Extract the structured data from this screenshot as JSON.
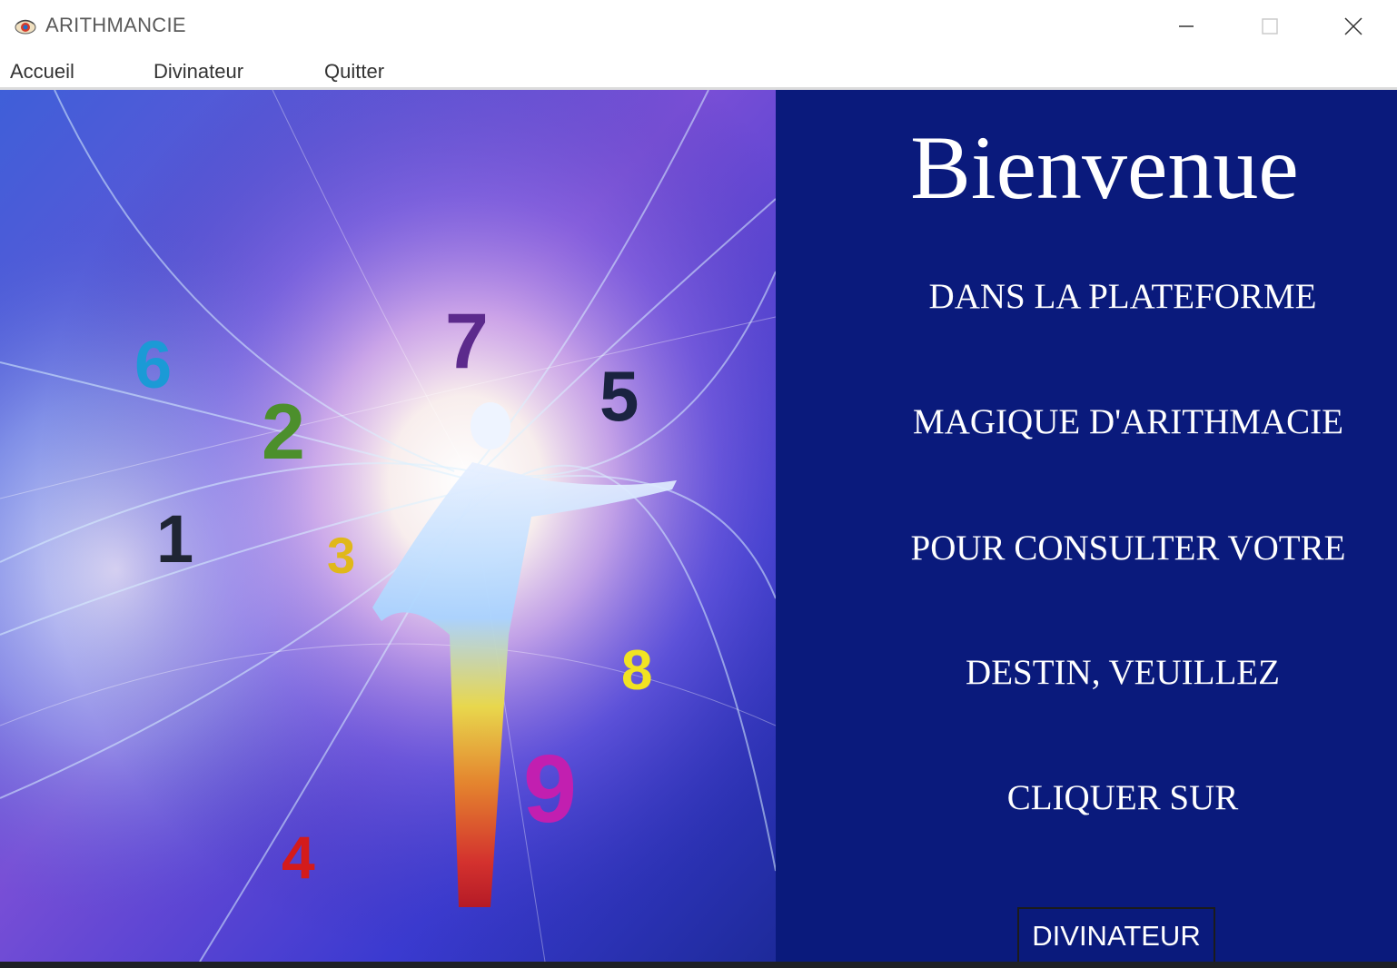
{
  "window": {
    "title": "ARITHMANCIE",
    "icon": "app-eye-icon"
  },
  "window_controls": {
    "minimize_icon": "minimize-icon",
    "maximize_icon": "maximize-icon",
    "close_icon": "close-icon"
  },
  "menu": {
    "items": [
      {
        "label": "Accueil"
      },
      {
        "label": "Divinateur"
      },
      {
        "label": "Quitter"
      }
    ]
  },
  "illustration": {
    "digits": [
      {
        "digit": "6",
        "color": "#1b9ad6"
      },
      {
        "digit": "2",
        "color": "#4c8f2c"
      },
      {
        "digit": "7",
        "color": "#5c2a8c"
      },
      {
        "digit": "5",
        "color": "#1a2340"
      },
      {
        "digit": "1",
        "color": "#1f2533"
      },
      {
        "digit": "3",
        "color": "#e0b81a"
      },
      {
        "digit": "8",
        "color": "#f1e322"
      },
      {
        "digit": "9",
        "color": "#c21fb0"
      },
      {
        "digit": "4",
        "color": "#d41b1b"
      }
    ]
  },
  "welcome": {
    "heading": "Bienvenue",
    "lines": [
      "DANS LA PLATEFORME",
      "MAGIQUE D'ARITHMACIE",
      "POUR CONSULTER VOTRE",
      "DESTIN, VEUILLEZ",
      "CLIQUER SUR"
    ],
    "button_label": "DIVINATEUR"
  },
  "colors": {
    "panel_bg": "#0a1a7c",
    "text": "#ffffff"
  }
}
